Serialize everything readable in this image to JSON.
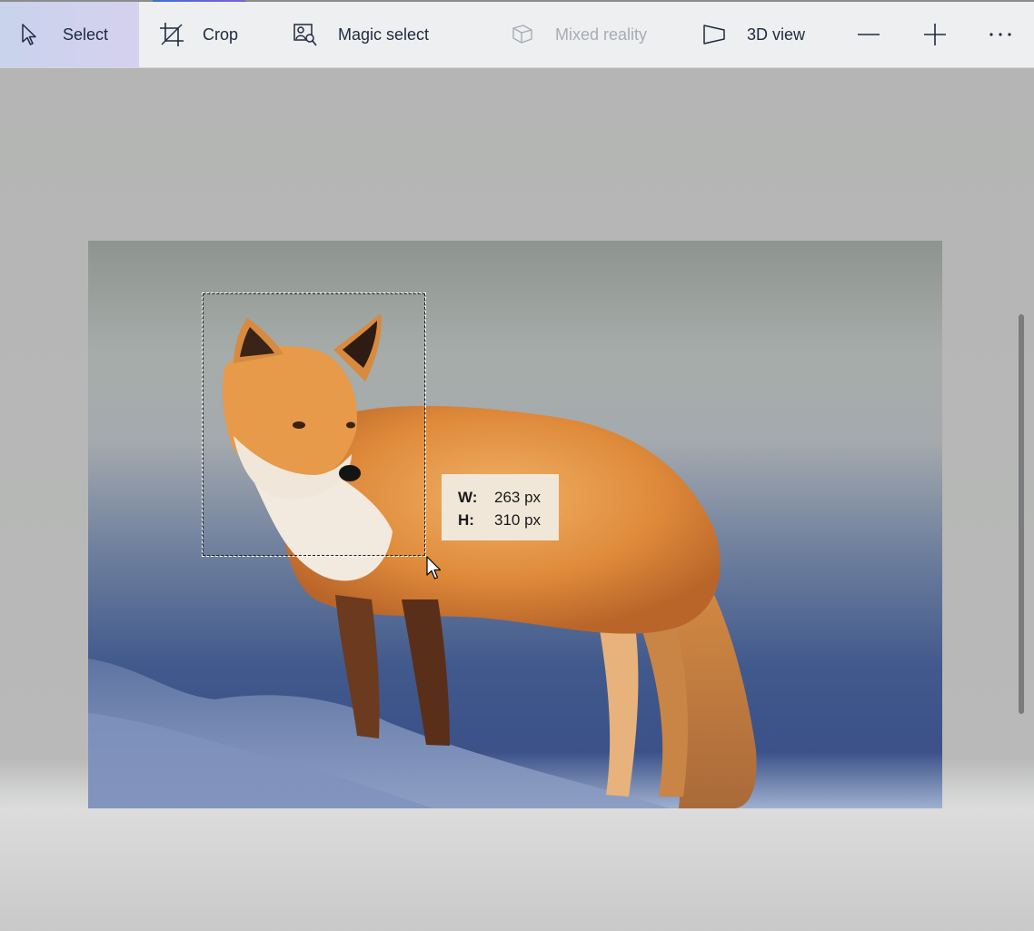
{
  "toolbar": {
    "tools": [
      {
        "label": "Select",
        "icon": "select-pointer-icon",
        "state": "active"
      },
      {
        "label": "Crop",
        "icon": "crop-icon",
        "state": "normal"
      },
      {
        "label": "Magic select",
        "icon": "magic-select-icon",
        "state": "normal"
      },
      {
        "label": "Mixed reality",
        "icon": "mixed-reality-icon",
        "state": "disabled"
      },
      {
        "label": "3D view",
        "icon": "3d-view-icon",
        "state": "normal"
      }
    ],
    "zoom_out_icon": "minus-icon",
    "zoom_in_icon": "plus-icon",
    "more_icon": "more-icon"
  },
  "canvas": {
    "image_subject": "red fox standing on snow",
    "selection_tooltip": {
      "w_label": "W:",
      "w_value": "263 px",
      "h_label": "H:",
      "h_value": "310 px"
    }
  },
  "colors": {
    "active_tool_bg": "#c9d3ec",
    "toolbar_bg": "#eeeff1",
    "accent": "#3f6fd8",
    "tooltip_bg": "#f1e7d9"
  }
}
